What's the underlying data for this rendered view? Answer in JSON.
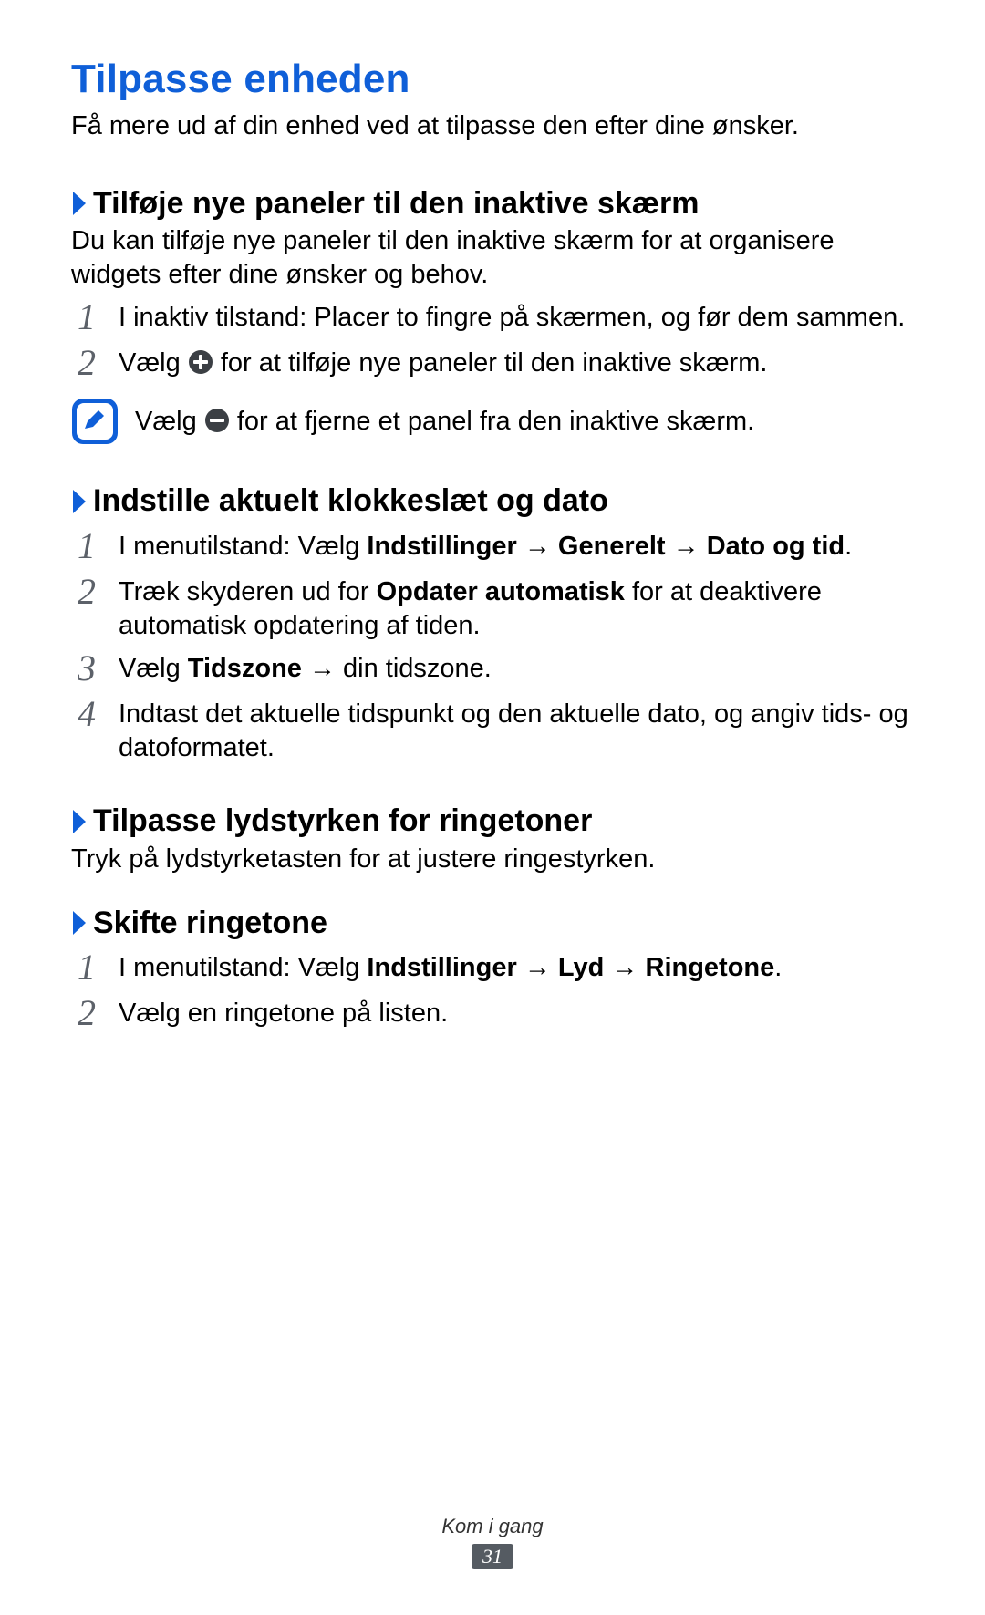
{
  "title": "Tilpasse enheden",
  "intro": "Få mere ud af din enhed ved at tilpasse den efter dine ønsker.",
  "sections": {
    "panels": {
      "heading": "Tilføje nye paneler til den inaktive skærm",
      "body": "Du kan tilføje nye paneler til den inaktive skærm for at organisere widgets efter dine ønsker og behov.",
      "step1": "I inaktiv tilstand: Placer to fingre på skærmen, og før dem sammen.",
      "step2_a": "Vælg ",
      "step2_b": " for at tilføje nye paneler til den inaktive skærm.",
      "note_a": "Vælg ",
      "note_b": " for at fjerne et panel fra den inaktive skærm."
    },
    "clock": {
      "heading": "Indstille aktuelt klokkeslæt og dato",
      "step1_a": "I menutilstand: Vælg ",
      "step1_b": "Indstillinger",
      "step1_c": "Generelt",
      "step1_d": "Dato og tid",
      "step2_a": "Træk skyderen ud for ",
      "step2_b": "Opdater automatisk",
      "step2_c": " for at deaktivere automatisk opdatering af tiden.",
      "step3_a": "Vælg ",
      "step3_b": "Tidszone",
      "step3_c": " → din tidszone.",
      "step4": "Indtast det aktuelle tidspunkt og den aktuelle dato, og angiv tids- og datoformatet."
    },
    "volume": {
      "heading": "Tilpasse lydstyrken for ringetoner",
      "body": "Tryk på lydstyrketasten for at justere ringestyrken."
    },
    "ringtone": {
      "heading": "Skifte ringetone",
      "step1_a": "I menutilstand: Vælg ",
      "step1_b": "Indstillinger",
      "step1_c": "Lyd",
      "step1_d": "Ringetone",
      "step2": "Vælg en ringetone på listen."
    }
  },
  "numbers": {
    "n1": "1",
    "n2": "2",
    "n3": "3",
    "n4": "4"
  },
  "arrow": " → ",
  "period": ".",
  "footer": {
    "label": "Kom i gang",
    "page": "31"
  },
  "icons": {
    "plus": "plus-circle-icon",
    "minus": "minus-circle-icon",
    "note": "note-pencil-icon"
  }
}
